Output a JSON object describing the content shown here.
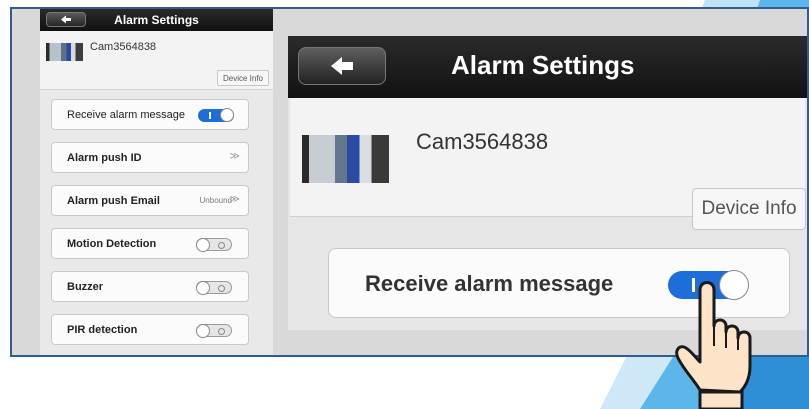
{
  "small_panel": {
    "title": "Alarm Settings",
    "camera_name": "Cam3564838",
    "device_info_label": "Device Info",
    "rows": [
      {
        "label": "Receive alarm message",
        "type": "toggle",
        "state": "on"
      },
      {
        "label": "Alarm push ID",
        "type": "link",
        "chevron": "≫"
      },
      {
        "label": "Alarm push Email",
        "type": "link",
        "value": "Unbound",
        "chevron": "≫"
      },
      {
        "label": "Motion Detection",
        "type": "toggle",
        "state": "off"
      },
      {
        "label": "Buzzer",
        "type": "toggle",
        "state": "off"
      },
      {
        "label": "PIR detection",
        "type": "toggle",
        "state": "off"
      }
    ]
  },
  "zoom_panel": {
    "title": "Alarm Settings",
    "camera_name": "Cam3564838",
    "device_info_label": "Device Info",
    "receive_label": "Receive alarm message",
    "receive_state": "on"
  },
  "colors": {
    "frame_border": "#2f5e8e",
    "toggle_on": "#1d6ed8",
    "header": "#1a1a1a",
    "accent_stripe": "#4aa8e6"
  },
  "icons": [
    "back-arrow-icon",
    "chevron-right-icon",
    "pointing-hand-icon"
  ]
}
